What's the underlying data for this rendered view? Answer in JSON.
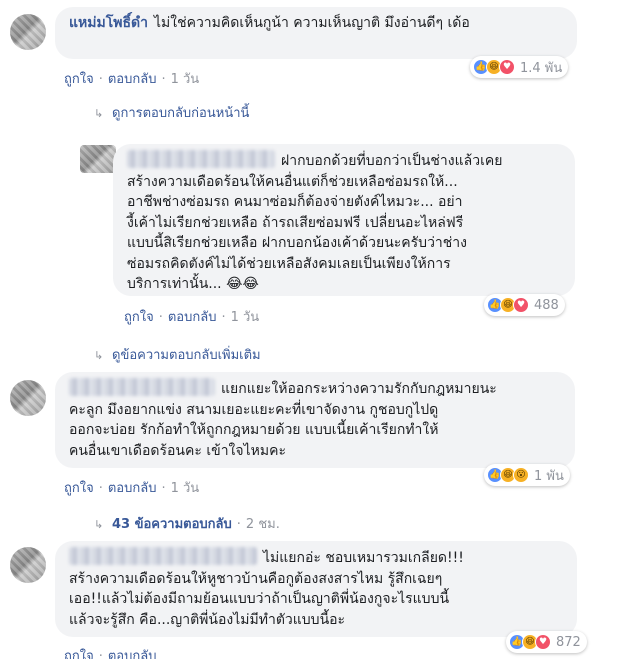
{
  "comments": [
    {
      "author": "แหม่มโพธิ์ดำ",
      "text": "ไม่ใช่ความคิดเห็นกูน้า ความเห็นญาติ มึงอ่านดีๆ เด้อ",
      "reaction_count": "1.4 พัน",
      "like": "ถูกใจ",
      "reply": "ตอบกลับ",
      "time": "1 วัน"
    },
    {
      "text_lines": [
        "ฝากบอกด้วยที่บอกว่าเป็นช่างแล้วเคย",
        "สร้างความเดือดร้อนให้คนอื่นแต่ก็ช่วยเหลือซ่อมรถให้...",
        "อาชีพช่างซ่อมรถ คนมาซ่อมก็ต้องจ่ายตังค์ไหมวะ... อย่า",
        "งี้เค้าไม่เรียกช่วยเหลือ ถ้ารถเสียซ่อมฟรี เปลี่ยนอะไหล่ฟรี",
        "แบบนี้สิเรียกช่วยเหลือ ฝากบอกน้องเค้าด้วยนะครับว่าช่าง",
        "ซ่อมรถคิดตังค์ไม่ได้ช่วยเหลือสังคมเลยเป็นเพียงให้การ",
        "บริการเท่านั้น... 😂😂"
      ],
      "reaction_count": "488",
      "like": "ถูกใจ",
      "reply": "ตอบกลับ",
      "time": "1 วัน"
    },
    {
      "text_lines": [
        "แยกแยะให้ออกระหว่างความรักกับกฎหมายนะ",
        "คะลูก มึงอยากแข่ง สนามเยอะแยะคะที่เขาจัดงาน กูชอบกูไปดู",
        "ออกจะบ่อย รักก้อทำให้ถูกกฎหมายด้วย แบบเนี้ยเค้าเรียกทำให้",
        "คนอื่นเขาเดือดร้อนคะ เข้าใจไหมคะ"
      ],
      "reaction_count": "1 พัน",
      "like": "ถูกใจ",
      "reply": "ตอบกลับ",
      "time": "1 วัน"
    },
    {
      "text_lines": [
        "ไม่แยกอ่ะ ชอบเหมารวมเกลียด!!!",
        "สร้างความเดือดร้อนให้หูชาวบ้านคือกูต้องสงสารไหม รู้สึกเฉยๆ",
        "เออ!!แล้วไม่ต้องมีถามย้อนแบบว่าถ้าเป็นญาติพี่น้องกูจะไรแบบนี้",
        "แล้วจะรู้สึก คือ...ญาติพี่น้องไม่มีทำตัวแบบนี้อะ"
      ],
      "reaction_count": "872",
      "like": "ถูกใจ",
      "reply": "ตอบกลับ"
    }
  ],
  "earlier_replies": "ดูการตอบกลับก่อนหน้านี้",
  "more_replies": "ดูข้อความตอบกลับเพิ่มเติม",
  "replies_count_label": "43 ข้อความตอบกลับ",
  "replies_time": "2 ชม.",
  "dot": "·"
}
